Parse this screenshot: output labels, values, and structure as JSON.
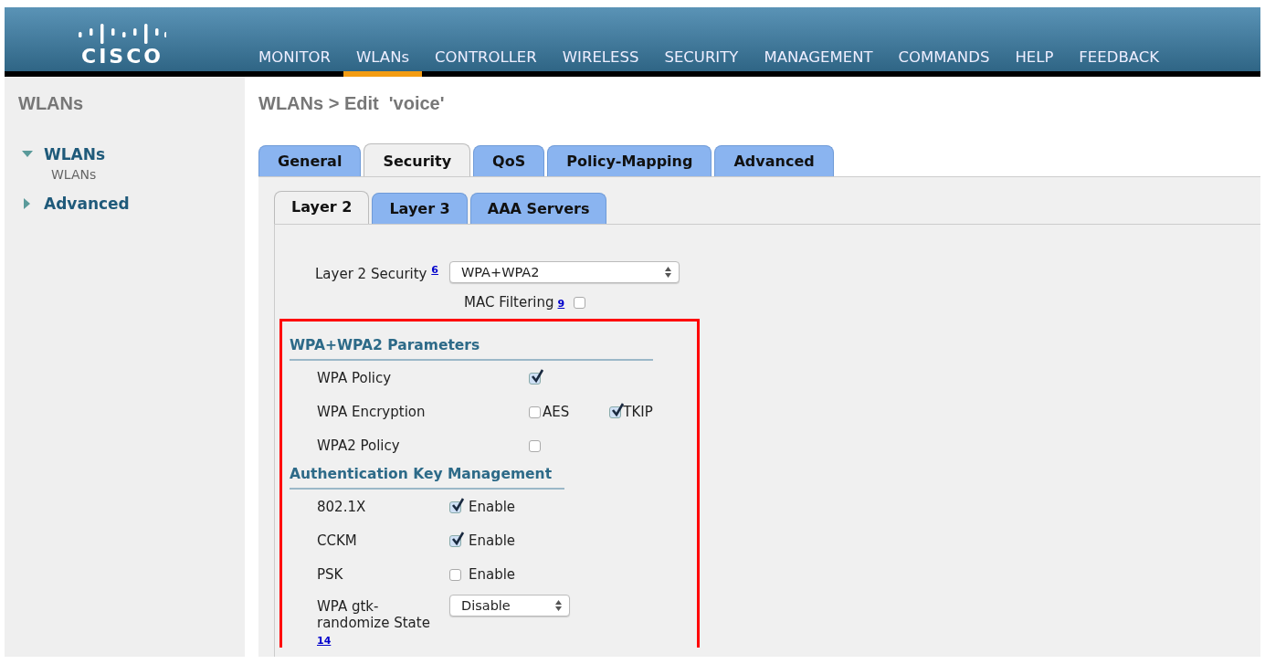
{
  "header": {
    "logo_text": "CISCO",
    "menu": [
      {
        "label": "MONITOR",
        "selected": false
      },
      {
        "label": "WLANs",
        "selected": true
      },
      {
        "label": "CONTROLLER",
        "selected": false
      },
      {
        "label": "WIRELESS",
        "selected": false
      },
      {
        "label": "SECURITY",
        "selected": false
      },
      {
        "label": "MANAGEMENT",
        "selected": false
      },
      {
        "label": "COMMANDS",
        "selected": false
      },
      {
        "label": "HELP",
        "selected": false
      },
      {
        "label": "FEEDBACK",
        "selected": false
      }
    ]
  },
  "sidebar": {
    "title": "WLANs",
    "items": [
      {
        "label": "WLANs",
        "expanded": true,
        "children": [
          {
            "label": "WLANs"
          }
        ]
      },
      {
        "label": "Advanced",
        "expanded": false
      }
    ]
  },
  "breadcrumb": "WLANs > Edit  'voice'",
  "tabs": [
    {
      "label": "General",
      "selected": false
    },
    {
      "label": "Security",
      "selected": true
    },
    {
      "label": "QoS",
      "selected": false
    },
    {
      "label": "Policy-Mapping",
      "selected": false
    },
    {
      "label": "Advanced",
      "selected": false
    }
  ],
  "subtabs": [
    {
      "label": "Layer 2",
      "selected": true
    },
    {
      "label": "Layer 3",
      "selected": false
    },
    {
      "label": "AAA Servers",
      "selected": false
    }
  ],
  "layer2_security": {
    "label": "Layer 2 Security",
    "note": "6",
    "value": "WPA+WPA2"
  },
  "mac_filtering": {
    "label": "MAC Filtering",
    "note": "9",
    "checked": false
  },
  "sections": [
    {
      "title": "WPA+WPA2 Parameters",
      "rows": [
        {
          "kind": "checkbox",
          "label": "WPA Policy",
          "checked": true
        },
        {
          "kind": "options",
          "label": "WPA Encryption",
          "options": [
            {
              "label": "AES",
              "checked": false
            },
            {
              "label": "TKIP",
              "checked": true
            }
          ]
        },
        {
          "kind": "checkbox",
          "label": "WPA2 Policy",
          "checked": false
        }
      ]
    },
    {
      "title": "Authentication Key Management",
      "rows": [
        {
          "kind": "enable",
          "label": "802.1X",
          "option": "Enable",
          "checked": true
        },
        {
          "kind": "enable",
          "label": "CCKM",
          "option": "Enable",
          "checked": true
        },
        {
          "kind": "enable",
          "label": "PSK",
          "option": "Enable",
          "checked": false
        },
        {
          "kind": "select",
          "label": "WPA gtk-randomize State",
          "note": "14",
          "value": "Disable"
        }
      ]
    }
  ]
}
